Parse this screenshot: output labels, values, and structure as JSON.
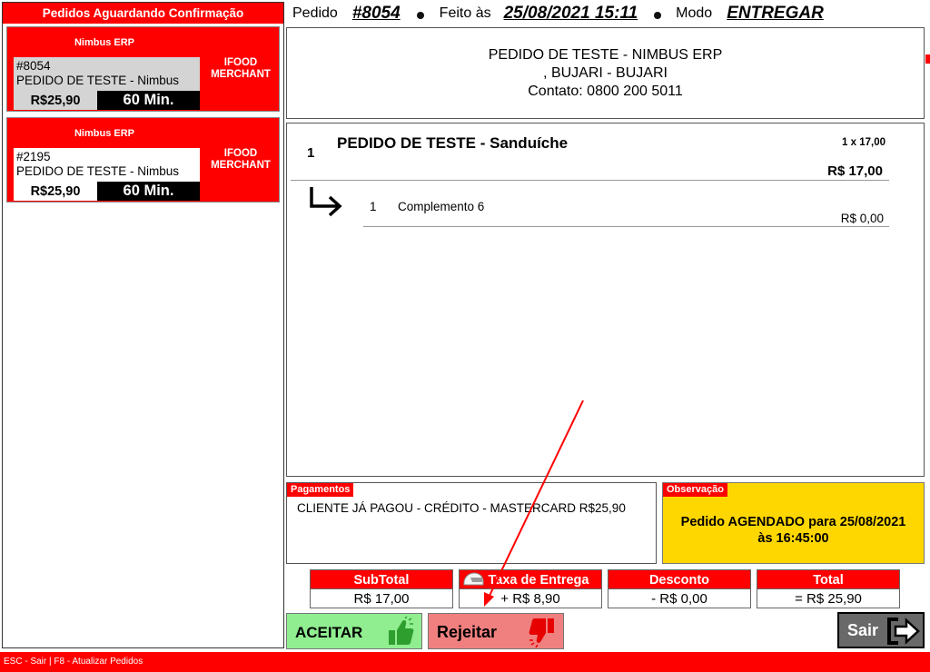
{
  "sidebar": {
    "title": "Pedidos Aguardando Confirmação",
    "orders": [
      {
        "erp": "Nimbus ERP",
        "number": "#8054",
        "customer": "PEDIDO DE TESTE - Nimbus",
        "price": "R$25,90",
        "time": "60 Min.",
        "merchant_line1": "IFOOD",
        "merchant_line2": "MERCHANT",
        "selected": true
      },
      {
        "erp": "Nimbus ERP",
        "number": "#2195",
        "customer": "PEDIDO DE TESTE - Nimbus",
        "price": "R$25,90",
        "time": "60 Min.",
        "merchant_line1": "IFOOD",
        "merchant_line2": "MERCHANT",
        "selected": false
      }
    ]
  },
  "header": {
    "order_label": "Pedido",
    "order_number": "#8054",
    "made_label": "Feito às",
    "made_datetime": "25/08/2021 15:11",
    "mode_label": "Modo",
    "mode_value": "ENTREGAR"
  },
  "store": {
    "name": "PEDIDO DE TESTE - NIMBUS ERP",
    "address": ", BUJARI - BUJARI",
    "contact": "Contato: 0800 200 5011"
  },
  "items": [
    {
      "qty": "1",
      "name": "PEDIDO DE TESTE - Sanduíche",
      "unit_price": "1 x 17,00",
      "total": "R$ 17,00",
      "complements": [
        {
          "qty": "1",
          "name": "Complemento 6",
          "price": "R$ 0,00"
        }
      ]
    }
  ],
  "payments": {
    "label": "Pagamentos",
    "text": "CLIENTE JÁ PAGOU - CRÉDITO - MASTERCARD R$25,90"
  },
  "observation": {
    "label": "Observação",
    "line1": "Pedido AGENDADO para 25/08/2021",
    "line2": "às 16:45:00"
  },
  "totals": {
    "subtotal_label": "SubTotal",
    "subtotal_value": "R$ 17,00",
    "delivery_label": "Taxa de Entrega",
    "delivery_value": "+ R$ 8,90",
    "discount_label": "Desconto",
    "discount_value": "- R$ 0,00",
    "total_label": "Total",
    "total_value": "= R$ 25,90"
  },
  "buttons": {
    "accept": "ACEITAR",
    "reject": "Rejeitar",
    "exit": "Sair"
  },
  "status_bar": "ESC - Sair  | F8 - Atualizar Pedidos",
  "icons": [
    "thumbs-up-icon",
    "thumbs-down-icon",
    "exit-icon",
    "motorcycle-helmet-icon",
    "return-arrow-icon"
  ],
  "colors": {
    "accent_red": "#ff0000",
    "accept_green": "#90ee90",
    "reject_red": "#f08080",
    "observation_yellow": "#ffd700",
    "exit_gray": "#696969",
    "selected_gray": "#d4d4d4"
  }
}
